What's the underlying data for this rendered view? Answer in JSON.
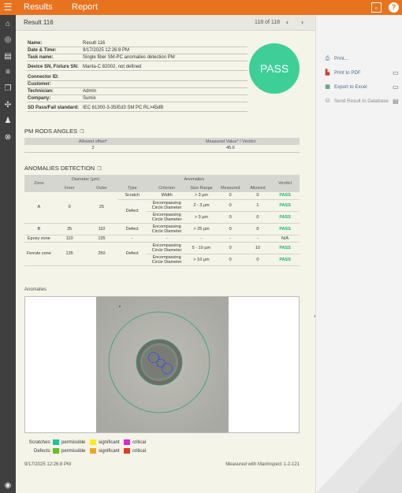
{
  "topbar": {
    "tabs": [
      "Results",
      "Report"
    ],
    "menu_icon": "hamburger-icon",
    "right_icons": [
      "display-settings-icon",
      "help-icon"
    ]
  },
  "leftnav": {
    "icons": [
      "home-icon",
      "target-icon",
      "map-icon",
      "tune-icon",
      "copy-icon",
      "tools-icon",
      "users-icon",
      "circle-x-icon"
    ],
    "bottom_icon": "account-icon"
  },
  "header": {
    "title": "Result 116",
    "counter": "118 of 118",
    "prev": "‹",
    "next": "›"
  },
  "info": [
    {
      "k": "Name:",
      "v": "Result 116"
    },
    {
      "k": "Date & Time:",
      "v": "9/17/2025 12:26:8 PM"
    },
    {
      "k": "Task name:",
      "v": "Single fiber SM-PC anomalies detection PM"
    },
    {
      "k": "Device SN, Fixture SN:",
      "v": "Manta-C 82002, not defined"
    },
    {
      "k": "Connector ID:",
      "v": ""
    },
    {
      "k": "Customer:",
      "v": ""
    },
    {
      "k": "Technician:",
      "v": "Admin"
    },
    {
      "k": "Company:",
      "v": "Sumix"
    },
    {
      "k": "SD Pass/Fail standard:",
      "v": "IEC 61300-3-35/Ed3 SM PC RL>45dB"
    }
  ],
  "verdict": "PASS",
  "rods": {
    "title": "PM RODS ANGLES",
    "headers": [
      "Allowed offset°",
      "Measured Value° / Verdict"
    ],
    "row": [
      "2",
      "45.6"
    ]
  },
  "anomalies": {
    "title": "ANOMALIES DETECTION",
    "h_zone": "Zone",
    "h_diam": "Diameter (µm)",
    "h_anom": "Anomalies",
    "h_verdict": "Verdict",
    "h_inner": "Inner",
    "h_outer": "Outer",
    "h_type": "Type",
    "h_criterion": "Criterion",
    "h_size": "Size Range",
    "h_measured": "Measured",
    "h_allowed": "Allowed",
    "zoneA": {
      "zone": "A",
      "inner": "0",
      "outer": "25"
    },
    "zoneB": {
      "zone": "B",
      "inner": "25",
      "outer": "110"
    },
    "zoneE": {
      "zone": "Epoxy zone",
      "inner": "110",
      "outer": "135",
      "type": "-",
      "criterion": "-",
      "size": "-",
      "measured": "-",
      "allowed": "-",
      "verdict": "N/A"
    },
    "zoneF": {
      "zone": "Ferrule zone",
      "inner": "135",
      "outer": "250"
    },
    "type_scratch": "Scratch",
    "type_defect": "Defect",
    "crit_width": "Width",
    "crit_ecd": "Encompassing Circle Diameter",
    "rows": {
      "a1": {
        "size": "> 3 µm",
        "measured": "0",
        "allowed": "0",
        "verdict": "PASS"
      },
      "a2": {
        "size": "2 - 3 µm",
        "measured": "0",
        "allowed": "1",
        "verdict": "PASS"
      },
      "a3": {
        "size": "> 3 µm",
        "measured": "0",
        "allowed": "0",
        "verdict": "PASS"
      },
      "b1": {
        "size": "> 25 µm",
        "measured": "0",
        "allowed": "0",
        "verdict": "PASS"
      },
      "f1": {
        "size": "5 - 10 µm",
        "measured": "0",
        "allowed": "10",
        "verdict": "PASS"
      },
      "f2": {
        "size": "> 10 µm",
        "measured": "0",
        "allowed": "0",
        "verdict": "PASS"
      }
    }
  },
  "image_label": "Anomalies",
  "legend": {
    "scratches_label": "Scratches:",
    "defects_label": "Defects:",
    "permissible": "permissible",
    "significant": "significant",
    "critical": "critical",
    "scratch_colors": [
      "#1cc49a",
      "#f5ef1a",
      "#e022d8"
    ],
    "defect_colors": [
      "#62c11f",
      "#f0a623",
      "#e43a1e"
    ]
  },
  "footer": {
    "left": "9/17/2025 12:26:8 PM",
    "right": "Measured with MaxInspect 1-2-121"
  },
  "actions": [
    {
      "label": "Print...",
      "icon": "printer-icon"
    },
    {
      "label": "Print to PDF",
      "icon": "pdf-icon"
    },
    {
      "label": "Export to Excel",
      "icon": "excel-icon"
    },
    {
      "label": "Send Result to Database",
      "icon": "database-icon"
    }
  ],
  "colors": {
    "accent": "#e8731f",
    "pass": "#3ecf99",
    "pass_text": "#1fb36f"
  }
}
